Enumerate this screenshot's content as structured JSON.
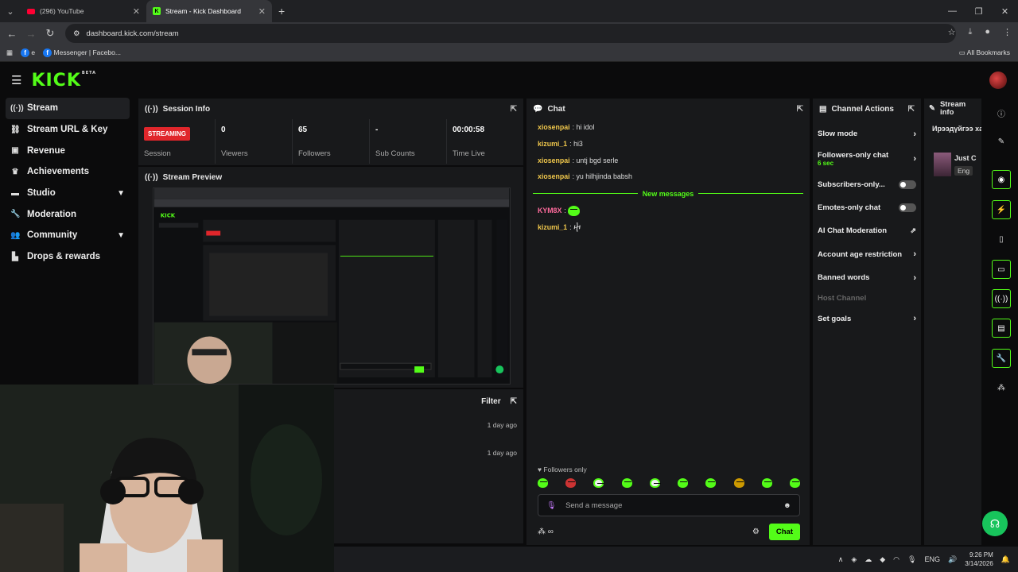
{
  "browser": {
    "tabs": [
      {
        "title": "(296) YouTube",
        "icon": "youtube-icon"
      },
      {
        "title": "Stream - Kick Dashboard",
        "icon": "kick-icon"
      }
    ],
    "url": "dashboard.kick.com/stream",
    "bookmarks": [
      {
        "label": "e",
        "icon": "facebook-icon"
      },
      {
        "label": "Messenger | Facebo...",
        "icon": "facebook-icon"
      }
    ],
    "all_bookmarks": "All Bookmarks"
  },
  "header": {
    "logo": "KICK",
    "beta": "BETA"
  },
  "sidebar": {
    "items": [
      {
        "label": "Stream",
        "icon": "stream-icon",
        "active": true
      },
      {
        "label": "Stream URL & Key",
        "icon": "link-icon"
      },
      {
        "label": "Revenue",
        "icon": "revenue-icon"
      },
      {
        "label": "Achievements",
        "icon": "trophy-icon"
      },
      {
        "label": "Studio",
        "icon": "studio-icon",
        "expandable": true
      },
      {
        "label": "Moderation",
        "icon": "wrench-icon"
      },
      {
        "label": "Community",
        "icon": "community-icon",
        "expandable": true
      },
      {
        "label": "Drops & rewards",
        "icon": "gift-icon"
      }
    ]
  },
  "session": {
    "title": "Session Info",
    "status": "STREAMING",
    "status_label": "Session",
    "stats": [
      {
        "value": "0",
        "label": "Viewers"
      },
      {
        "value": "65",
        "label": "Followers"
      },
      {
        "value": "-",
        "label": "Sub Counts"
      },
      {
        "value": "00:00:58",
        "label": "Time Live"
      }
    ]
  },
  "preview": {
    "title": "Stream Preview"
  },
  "activity": {
    "filter": "Filter",
    "rows": [
      "1 day ago",
      "1 day ago"
    ]
  },
  "chat": {
    "title": "Chat",
    "messages": [
      {
        "user": "xiosenpai",
        "color": "#f2c94c",
        "text": "hi idol"
      },
      {
        "user": "kizumi_1",
        "color": "#f2c94c",
        "text": "hi3"
      },
      {
        "user": "xiosenpai",
        "color": "#f2c94c",
        "text": "untj bgd serle"
      },
      {
        "user": "xiosenpai",
        "color": "#f2c94c",
        "text": "yu hilhjinda babsh"
      }
    ],
    "new_messages": "New messages",
    "new": [
      {
        "user": "KYM8X",
        "color": "#ff6b9d",
        "emote": true
      },
      {
        "user": "kizumi_1",
        "color": "#f2c94c",
        "emote": false
      }
    ],
    "followers_only": "Followers only",
    "placeholder": "Send a message",
    "send": "Chat",
    "infinity": "∞"
  },
  "actions": {
    "title": "Channel Actions",
    "items": [
      {
        "label": "Slow mode",
        "kind": "arrow"
      },
      {
        "label": "Followers-only chat",
        "sub": "6 sec",
        "kind": "arrow"
      },
      {
        "label": "Subscribers-only...",
        "kind": "toggle"
      },
      {
        "label": "Emotes-only chat",
        "kind": "toggle"
      },
      {
        "label": "AI Chat Moderation",
        "kind": "external"
      },
      {
        "label": "Account age restriction",
        "kind": "arrow"
      },
      {
        "label": "Banned words",
        "kind": "arrow"
      },
      {
        "label": "Host Channel",
        "kind": "disabled"
      },
      {
        "label": "Set goals",
        "kind": "arrow"
      }
    ]
  },
  "stream_info": {
    "title": "Stream info",
    "stream_title": "Ирээдүйгээ хамт",
    "category": "Just C",
    "language": "Eng"
  },
  "taskbar": {
    "lang": "ENG",
    "time": "9:26 PM",
    "date": "3/14/2026"
  }
}
